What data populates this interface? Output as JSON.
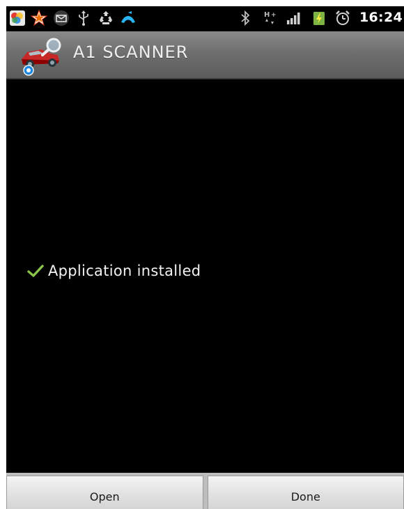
{
  "status_bar": {
    "time": "16:24",
    "icons_left": [
      "photos-icon",
      "star-icon",
      "email-icon",
      "usb-icon",
      "recycle-icon",
      "phone-call-icon"
    ],
    "icons_right": [
      "bluetooth-icon",
      "hplus-network-icon",
      "signal-bars-icon",
      "battery-charging-icon",
      "alarm-clock-icon"
    ],
    "hplus_label": "H+"
  },
  "title_bar": {
    "app_title": "A1 SCANNER",
    "app_icon": "car-scanner-icon"
  },
  "main": {
    "message": "Application installed",
    "message_icon": "checkmark-icon",
    "accent_color": "#8bc34a"
  },
  "buttons": {
    "open_label": "Open",
    "done_label": "Done"
  }
}
